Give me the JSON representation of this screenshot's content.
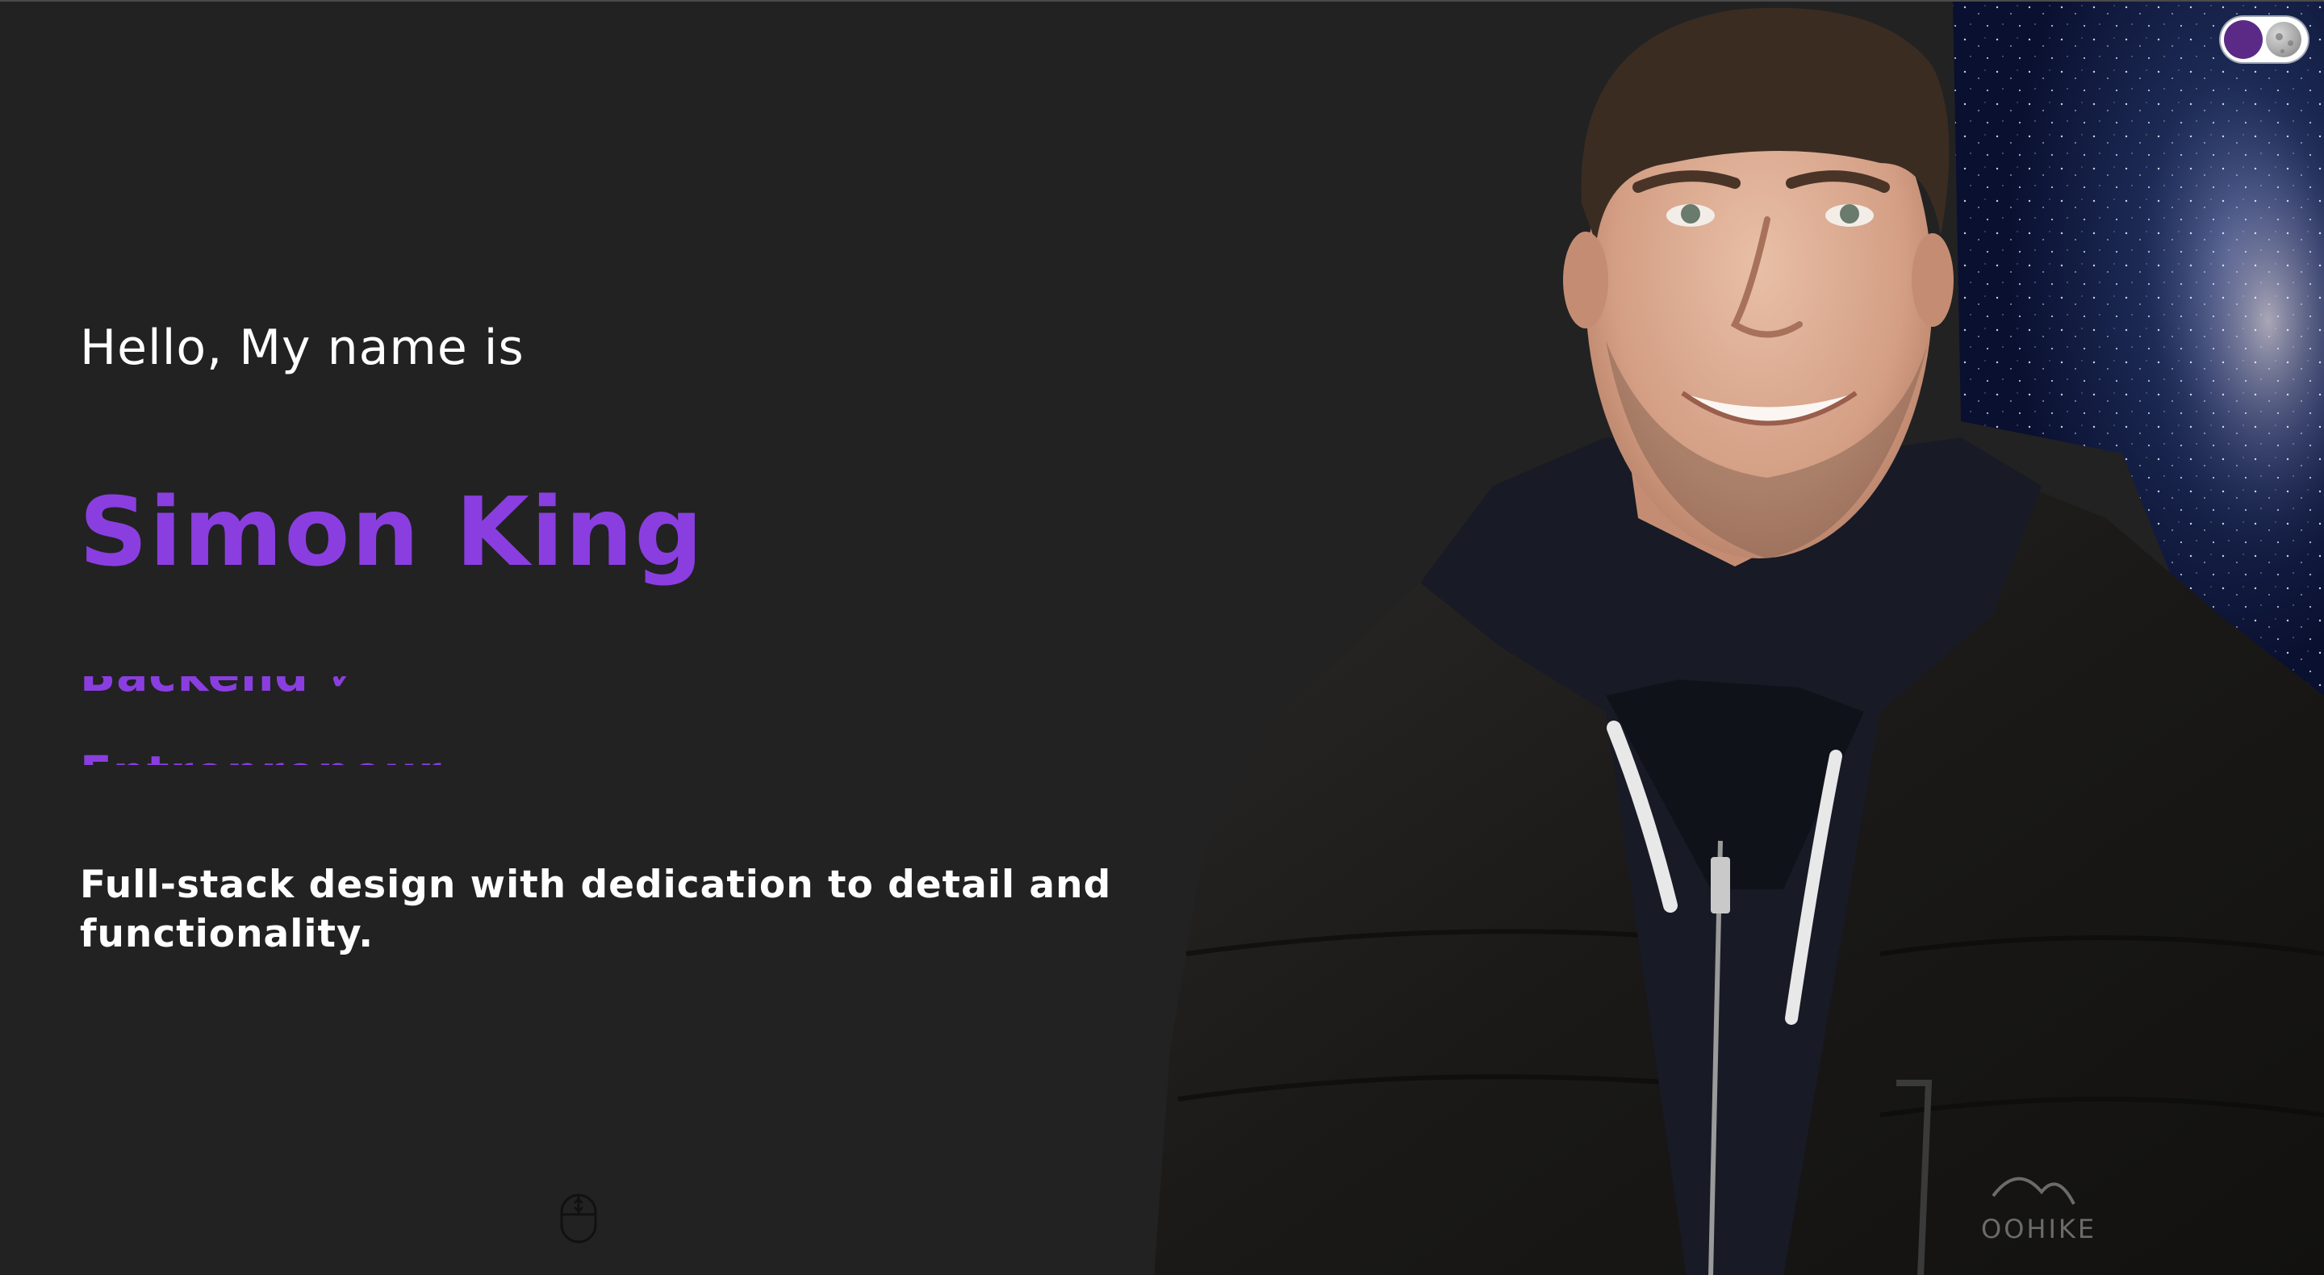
{
  "hero": {
    "greeting": "Hello, My name is",
    "name": "Simon King",
    "roles": [
      "Backend ✓",
      "Entrepreneur"
    ],
    "tagline": "Full-stack design with dedication to detail and functionality."
  },
  "theme_toggle": {
    "icon": "moon-icon"
  },
  "scroll_indicator": {
    "icon": "mouse-scroll-icon"
  },
  "colors": {
    "background": "#222222",
    "accent": "#8a3ee0",
    "text": "#ffffff",
    "toggle_knob": "#5b2a86"
  }
}
